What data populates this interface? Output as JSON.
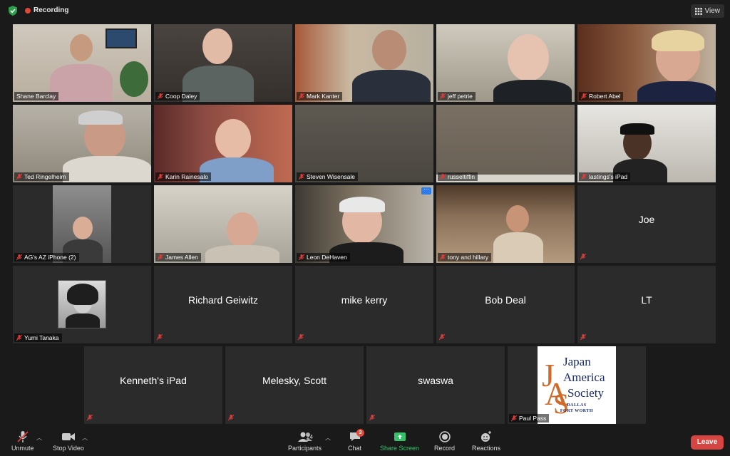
{
  "topbar": {
    "recording_label": "Recording",
    "view_label": "View"
  },
  "colors": {
    "active_speaker_border": "#d8d84a",
    "recording_dot": "#e0453a",
    "leave_button": "#d64541",
    "share_screen": "#36c26a"
  },
  "participants": [
    {
      "name": "Shane Barclay",
      "video": true,
      "active": true
    },
    {
      "name": "Coop Daley",
      "video": true
    },
    {
      "name": "Mark Kanter",
      "video": true
    },
    {
      "name": "jeff petrie",
      "video": true
    },
    {
      "name": "Robert Abel",
      "video": true
    },
    {
      "name": "Ted Ringelheim",
      "video": true
    },
    {
      "name": "Karin Rainesalo",
      "video": true
    },
    {
      "name": "Steven Wisensale",
      "video": true
    },
    {
      "name": "russeltiffin",
      "video": true
    },
    {
      "name": "lastings's iPad",
      "video": true
    },
    {
      "name": "AG's AZ iPhone (2)",
      "video": true
    },
    {
      "name": "James Allen",
      "video": true
    },
    {
      "name": "Leon DeHaven",
      "video": true
    },
    {
      "name": "tony and hillary",
      "video": true
    },
    {
      "name": "Joe",
      "video": false
    },
    {
      "name": "Yumi Tanaka",
      "video": false,
      "profile_photo": true
    },
    {
      "name": "Richard Geiwitz",
      "video": false
    },
    {
      "name": "mike kerry",
      "video": false
    },
    {
      "name": "Bob Deal",
      "video": false
    },
    {
      "name": "LT",
      "video": false
    },
    {
      "name": "Kenneth's iPad",
      "video": false
    },
    {
      "name": "Melesky, Scott",
      "video": false
    },
    {
      "name": "swaswa",
      "video": false
    },
    {
      "name": "Paul Pass",
      "video": false,
      "logo": true
    }
  ],
  "logo": {
    "line1": "Japan",
    "line2": "America",
    "line3": "Society",
    "sub1": "DALLAS",
    "sub2": "FORT WORTH"
  },
  "toolbar": {
    "unmute": "Unmute",
    "stop_video": "Stop Video",
    "participants": "Participants",
    "participants_count": "24",
    "chat": "Chat",
    "chat_badge": "3",
    "share_screen": "Share Screen",
    "record": "Record",
    "reactions": "Reactions",
    "leave": "Leave"
  },
  "icons": [
    "shield-check-icon",
    "grid-icon",
    "mic-muted-icon",
    "video-camera-icon",
    "participants-icon",
    "chat-icon",
    "share-screen-icon",
    "record-icon",
    "reactions-icon",
    "more-options-icon"
  ]
}
